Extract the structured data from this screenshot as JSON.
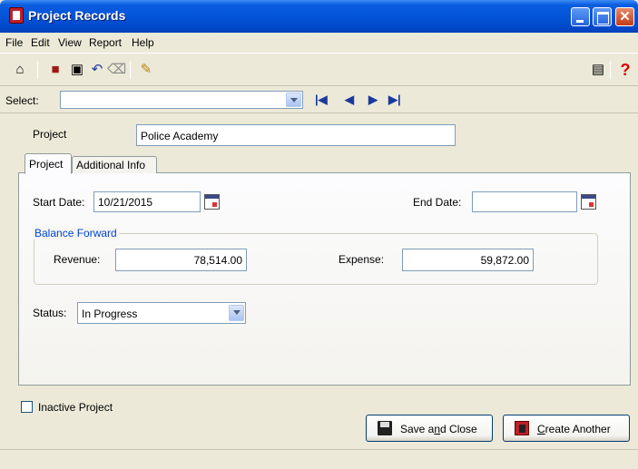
{
  "window": {
    "title": "Project Records"
  },
  "menu": [
    "File",
    "Edit",
    "View",
    "Report",
    "Help"
  ],
  "toolbar": {
    "icons": [
      "home-icon",
      "new-record-icon",
      "save-icon",
      "undo-icon",
      "delete-icon",
      "edit-icon",
      "report-icon",
      "help-icon"
    ]
  },
  "select": {
    "label": "Select:",
    "value": ""
  },
  "project": {
    "label": "Project",
    "value": "Police Academy"
  },
  "tabs": [
    {
      "label": "Project",
      "active": true
    },
    {
      "label": "Additional Info",
      "active": false
    }
  ],
  "form": {
    "start_date_label": "Start Date:",
    "start_date": "10/21/2015",
    "end_date_label": "End Date:",
    "end_date": "",
    "balance_forward": {
      "title": "Balance Forward",
      "revenue_label": "Revenue:",
      "revenue": "78,514.00",
      "expense_label": "Expense:",
      "expense": "59,872.00"
    },
    "status_label": "Status:",
    "status": "In Progress"
  },
  "inactive": {
    "label": "Inactive Project",
    "checked": false
  },
  "buttons": {
    "save_close": {
      "pre": "Save a",
      "key": "n",
      "post": "d Close"
    },
    "create_another": {
      "pre": "",
      "key": "C",
      "post": "reate Another"
    }
  },
  "colors": {
    "title_bar": "#0454d8",
    "group_title": "#0046d5",
    "window_bg": "#ece9d8"
  }
}
